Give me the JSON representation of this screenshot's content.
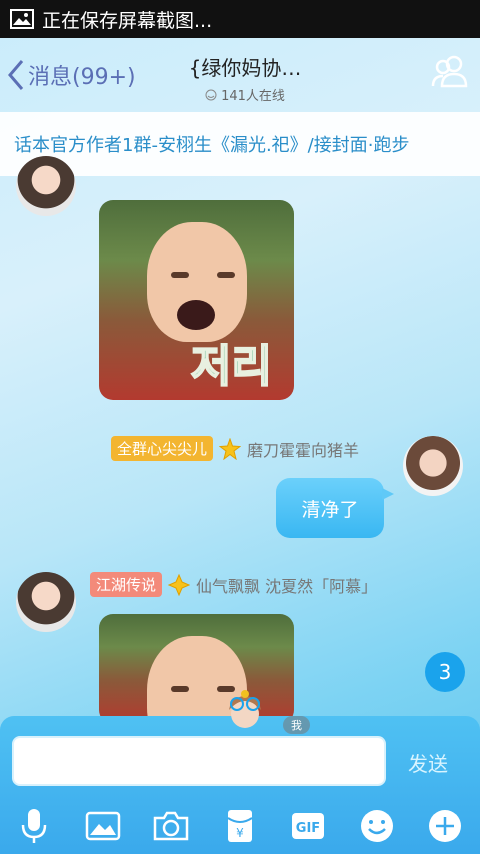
{
  "status_bar": {
    "text": "正在保存屏幕截图..."
  },
  "header": {
    "back_label": "消息(99+)",
    "title": "{绿你妈协…",
    "online": "141人在线"
  },
  "banner": {
    "text": "话本官方作者1群-安栩生《漏光.祀》/接封面·跑步"
  },
  "messages": [
    {
      "type": "image",
      "sticker_text": "저리"
    },
    {
      "type": "text",
      "tag": "全群心尖尖儿",
      "nickname": "磨刀霍霍向猪羊",
      "text": "清净了"
    },
    {
      "type": "image",
      "tag": "江湖传说",
      "nickname": "仙气飘飘 沈夏然「阿慕」"
    }
  ],
  "unread_count": "3",
  "me_label": "我",
  "input": {
    "placeholder": "",
    "send_label": "发送"
  },
  "toolbar": [
    "voice-icon",
    "picture-icon",
    "camera-icon",
    "red-packet-icon",
    "gif-icon",
    "emoji-icon",
    "plus-icon"
  ],
  "gif_label": "GIF",
  "red_packet_label": "¥",
  "colors": {
    "accent": "#3aa9ec",
    "bubble": "#4fc1f3",
    "title_link": "#5b6fb5"
  }
}
